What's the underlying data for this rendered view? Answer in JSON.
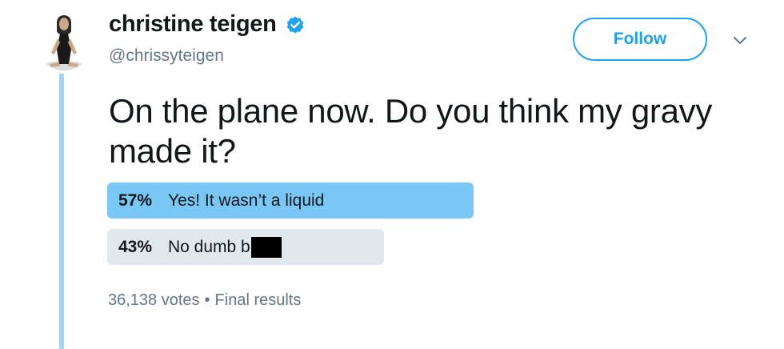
{
  "author": {
    "display_name": "christine teigen",
    "username": "@chrissyteigen",
    "verified": true,
    "avatar_icon": "profile-photo"
  },
  "actions": {
    "follow_label": "Follow",
    "menu_icon": "chevron-down-icon"
  },
  "tweet": {
    "text": "On the plane now. Do you think my gravy made it?"
  },
  "poll": {
    "options": [
      {
        "percent": "57%",
        "label": "Yes! It wasn’t a liquid",
        "fraction": 0.57,
        "winner": true
      },
      {
        "percent": "43%",
        "label": "No dumb b",
        "fraction": 0.43,
        "winner": false,
        "redacted": true
      }
    ],
    "votes": "36,138 votes",
    "separator": "•",
    "status": "Final results"
  },
  "colors": {
    "accent": "#1da1f2",
    "winner_bar": "#79c7f5",
    "other_bar": "#e1e8ed",
    "thread_line": "#a3d4f5",
    "secondary_text": "#657786"
  }
}
